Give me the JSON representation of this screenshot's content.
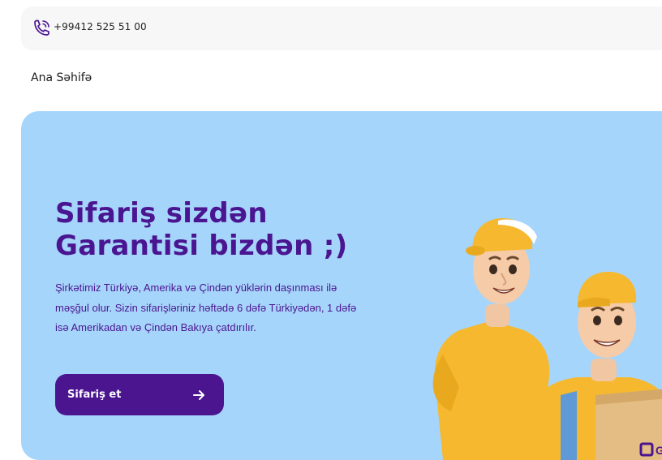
{
  "topbar": {
    "phone": "+99412 525 51 00",
    "phone_icon": "phone-call-icon"
  },
  "nav": {
    "home": "Ana Səhifə"
  },
  "hero": {
    "title_line1": "Sifariş sizdən",
    "title_line2": "Garantisi bizdən ;)",
    "description": "Şirkətimiz Türkiyə, Amerika və Çindən yüklərin daşınması ilə məşğul olur. Sizin sifarişləriniz həftədə 6 dəfə Türkiyədən, 1 dəfə isə Amerikadan və Çindən Bakıya çatdırılır.",
    "cta_label": "Sifariş et",
    "cta_icon": "arrow-right-icon",
    "box_brand": "Gara"
  },
  "colors": {
    "brand": "#4b1590",
    "hero_bg": "#a6d5fb",
    "topbar_bg": "#f7f7f8",
    "uniform_yellow": "#f5b82e"
  }
}
